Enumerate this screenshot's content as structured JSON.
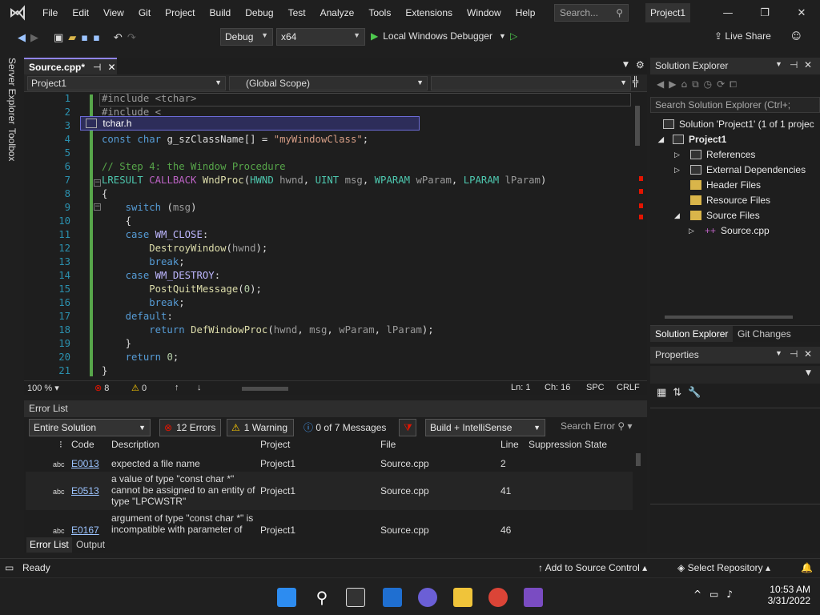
{
  "menu": [
    "File",
    "Edit",
    "View",
    "Git",
    "Project",
    "Build",
    "Debug",
    "Test",
    "Analyze",
    "Tools",
    "Extensions",
    "Window",
    "Help"
  ],
  "search": {
    "placeholder": "Search..."
  },
  "project_badge": "Project1",
  "toolbar": {
    "config": "Debug",
    "platform": "x64",
    "run_label": "Local Windows Debugger",
    "live_share": "Live Share"
  },
  "left_strip": {
    "server_explorer": "Server Explorer",
    "toolbox": "Toolbox"
  },
  "doc_tab": {
    "title": "Source.cpp*",
    "pin": "⊣",
    "close": "✕"
  },
  "nav": {
    "project": "Project1",
    "scope": "(Global Scope)",
    "member": ""
  },
  "editor": {
    "lines": [
      {
        "n": "1",
        "tokens": [
          {
            "t": "#include ",
            "c": "pp"
          },
          {
            "t": "<tchar>",
            "c": "pp"
          }
        ]
      },
      {
        "n": "2",
        "tokens": [
          {
            "t": "#include <",
            "c": "pp"
          }
        ]
      },
      {
        "n": "3",
        "tokens": [
          {
            "t": "",
            "c": ""
          }
        ]
      },
      {
        "n": "4",
        "tokens": [
          {
            "t": "const ",
            "c": "kw"
          },
          {
            "t": "char ",
            "c": "kw"
          },
          {
            "t": "g_szClassName[] = ",
            "c": ""
          },
          {
            "t": "\"myWindowClass\"",
            "c": "str"
          },
          {
            "t": ";",
            "c": ""
          }
        ]
      },
      {
        "n": "5",
        "tokens": [
          {
            "t": "",
            "c": ""
          }
        ]
      },
      {
        "n": "6",
        "tokens": [
          {
            "t": "// Step 4: the Window Procedure",
            "c": "cm"
          }
        ]
      },
      {
        "n": "7",
        "tokens": [
          {
            "t": "LRESULT ",
            "c": "ty"
          },
          {
            "t": "CALLBACK ",
            "c": "mac"
          },
          {
            "t": "WndProc",
            "c": "fn"
          },
          {
            "t": "(",
            "c": ""
          },
          {
            "t": "HWND ",
            "c": "ty"
          },
          {
            "t": "hwnd",
            "c": "par"
          },
          {
            "t": ", ",
            "c": ""
          },
          {
            "t": "UINT ",
            "c": "ty"
          },
          {
            "t": "msg",
            "c": "par"
          },
          {
            "t": ", ",
            "c": ""
          },
          {
            "t": "WPARAM ",
            "c": "ty"
          },
          {
            "t": "wParam",
            "c": "par"
          },
          {
            "t": ", ",
            "c": ""
          },
          {
            "t": "LPARAM ",
            "c": "ty"
          },
          {
            "t": "lParam",
            "c": "par"
          },
          {
            "t": ")",
            "c": ""
          }
        ]
      },
      {
        "n": "8",
        "tokens": [
          {
            "t": "{",
            "c": ""
          }
        ]
      },
      {
        "n": "9",
        "tokens": [
          {
            "t": "    switch ",
            "c": "kw"
          },
          {
            "t": "(",
            "c": ""
          },
          {
            "t": "msg",
            "c": "par"
          },
          {
            "t": ")",
            "c": ""
          }
        ]
      },
      {
        "n": "10",
        "tokens": [
          {
            "t": "    {",
            "c": ""
          }
        ]
      },
      {
        "n": "11",
        "tokens": [
          {
            "t": "    case ",
            "c": "kw"
          },
          {
            "t": "WM_CLOSE",
            "c": "cst"
          },
          {
            "t": ":",
            "c": ""
          }
        ]
      },
      {
        "n": "12",
        "tokens": [
          {
            "t": "        DestroyWindow",
            "c": "fn"
          },
          {
            "t": "(",
            "c": ""
          },
          {
            "t": "hwnd",
            "c": "par"
          },
          {
            "t": ");",
            "c": ""
          }
        ]
      },
      {
        "n": "13",
        "tokens": [
          {
            "t": "        break",
            "c": "kw"
          },
          {
            "t": ";",
            "c": ""
          }
        ]
      },
      {
        "n": "14",
        "tokens": [
          {
            "t": "    case ",
            "c": "kw"
          },
          {
            "t": "WM_DESTROY",
            "c": "cst"
          },
          {
            "t": ":",
            "c": ""
          }
        ]
      },
      {
        "n": "15",
        "tokens": [
          {
            "t": "        PostQuitMessage",
            "c": "fn"
          },
          {
            "t": "(",
            "c": ""
          },
          {
            "t": "0",
            "c": "num"
          },
          {
            "t": ");",
            "c": ""
          }
        ]
      },
      {
        "n": "16",
        "tokens": [
          {
            "t": "        break",
            "c": "kw"
          },
          {
            "t": ";",
            "c": ""
          }
        ]
      },
      {
        "n": "17",
        "tokens": [
          {
            "t": "    default",
            "c": "kw"
          },
          {
            "t": ":",
            "c": ""
          }
        ]
      },
      {
        "n": "18",
        "tokens": [
          {
            "t": "        return ",
            "c": "kw"
          },
          {
            "t": "DefWindowProc",
            "c": "fn"
          },
          {
            "t": "(",
            "c": ""
          },
          {
            "t": "hwnd",
            "c": "par"
          },
          {
            "t": ", ",
            "c": ""
          },
          {
            "t": "msg",
            "c": "par"
          },
          {
            "t": ", ",
            "c": ""
          },
          {
            "t": "wParam",
            "c": "par"
          },
          {
            "t": ", ",
            "c": ""
          },
          {
            "t": "lParam",
            "c": "par"
          },
          {
            "t": ");",
            "c": ""
          }
        ]
      },
      {
        "n": "19",
        "tokens": [
          {
            "t": "    }",
            "c": ""
          }
        ]
      },
      {
        "n": "20",
        "tokens": [
          {
            "t": "    return ",
            "c": "kw"
          },
          {
            "t": "0",
            "c": "num"
          },
          {
            "t": ";",
            "c": ""
          }
        ]
      },
      {
        "n": "21",
        "tokens": [
          {
            "t": "}",
            "c": ""
          }
        ]
      }
    ],
    "autocomplete_item": "tchar.h"
  },
  "editor_status": {
    "zoom": "100 %",
    "errors": "8",
    "warnings": "0",
    "ln": "Ln: 1",
    "ch": "Ch: 16",
    "spc": "SPC",
    "eol": "CRLF"
  },
  "error_list": {
    "title": "Error List",
    "scope": "Entire Solution",
    "errors_btn": "12 Errors",
    "warnings_btn": "1 Warning",
    "messages_btn": "0 of 7 Messages",
    "build_filter": "Build + IntelliSense",
    "search_placeholder": "Search Error",
    "columns": [
      "Code",
      "Description",
      "Project",
      "File",
      "Line",
      "Suppression State"
    ],
    "rows": [
      {
        "code": "E0013",
        "desc": "expected a file name",
        "project": "Project1",
        "file": "Source.cpp",
        "line": "2"
      },
      {
        "code": "E0513",
        "desc": "a value of type \"const char *\" cannot be assigned to an entity of type \"LPCWSTR\"",
        "project": "Project1",
        "file": "Source.cpp",
        "line": "41"
      },
      {
        "code": "E0167",
        "desc": "argument of type \"const char *\" is incompatible with parameter of",
        "project": "Project1",
        "file": "Source.cpp",
        "line": "46"
      }
    ],
    "tabs": [
      "Error List",
      "Output"
    ]
  },
  "solution_explorer": {
    "title": "Solution Explorer",
    "search_placeholder": "Search Solution Explorer (Ctrl+;",
    "items": [
      {
        "label": "Solution 'Project1' (1 of 1 projec",
        "icon": "solution-icon"
      },
      {
        "label": "Project1",
        "icon": "project-icon"
      },
      {
        "label": "References",
        "icon": "references-icon"
      },
      {
        "label": "External Dependencies",
        "icon": "external-deps-icon"
      },
      {
        "label": "Header Files",
        "icon": "folder-icon"
      },
      {
        "label": "Resource Files",
        "icon": "folder-icon"
      },
      {
        "label": "Source Files",
        "icon": "folder-icon"
      },
      {
        "label": "Source.cpp",
        "icon": "cpp-file-icon"
      }
    ],
    "tabs": [
      "Solution Explorer",
      "Git Changes"
    ]
  },
  "properties": {
    "title": "Properties"
  },
  "statusbar": {
    "ready": "Ready",
    "source_control": "Add to Source Control",
    "repo": "Select Repository"
  },
  "taskbar": {
    "time": "10:53 AM",
    "date": "3/31/2022"
  },
  "colors": {
    "accent": "#9184ee",
    "error": "#e51400",
    "warning": "#ffcc00",
    "background": "#1e1e1e"
  }
}
